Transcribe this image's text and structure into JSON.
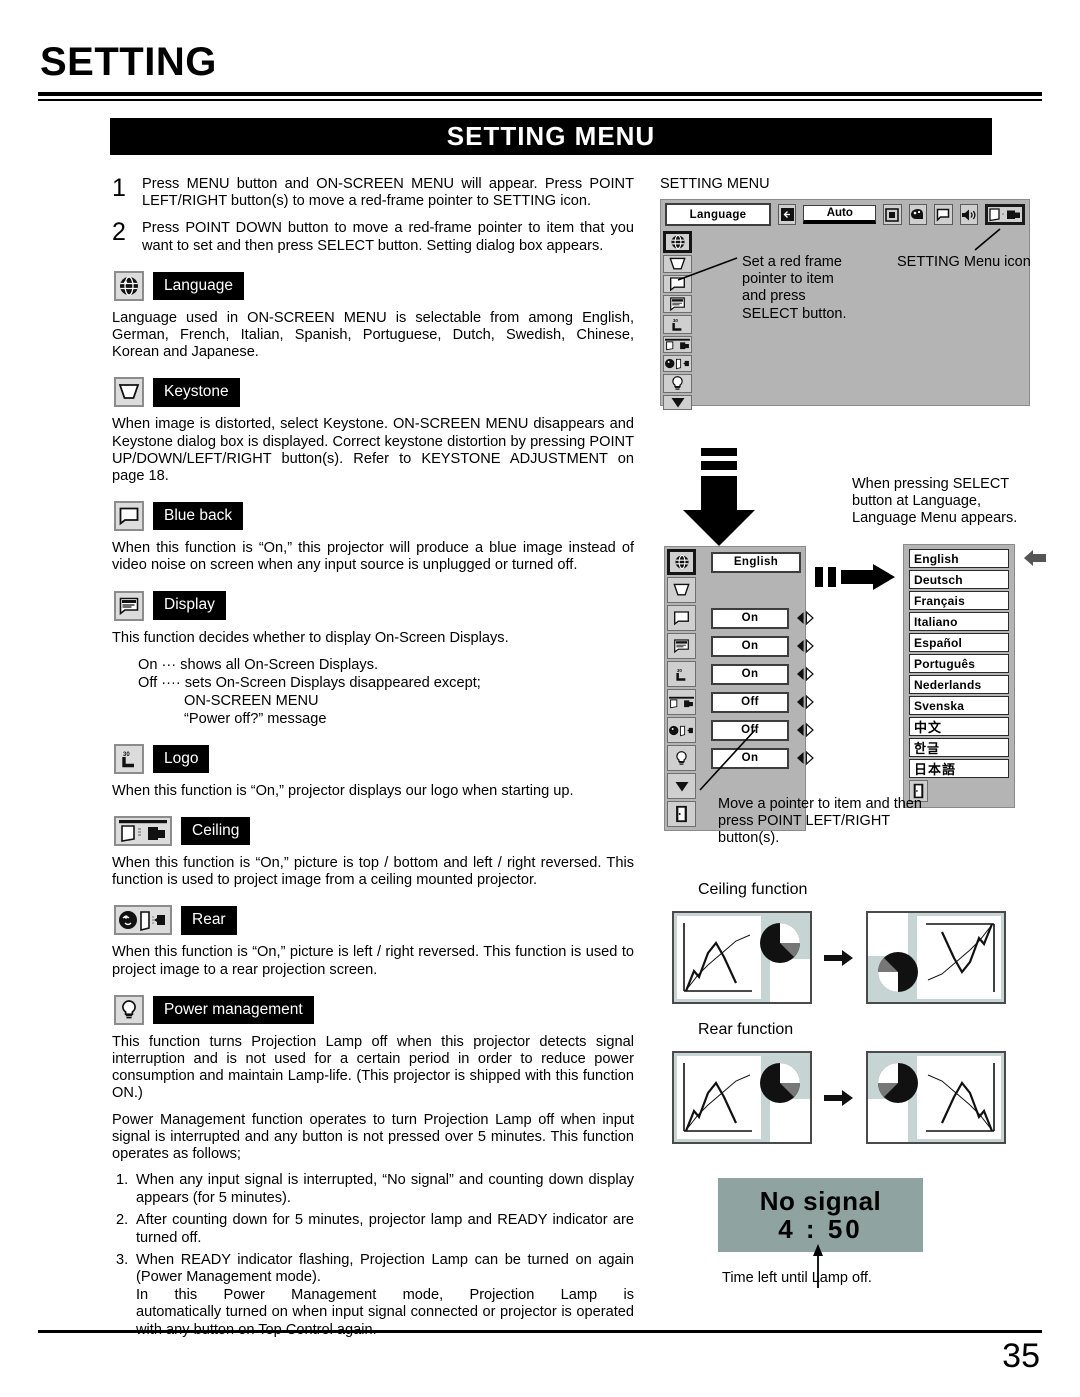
{
  "page": {
    "chapter_title": "SETTING",
    "banner_title": "SETTING MENU",
    "page_number": "35"
  },
  "steps": [
    {
      "num": "1",
      "text": "Press MENU button and ON-SCREEN MENU will appear.  Press POINT LEFT/RIGHT button(s) to move a red-frame pointer to SETTING icon."
    },
    {
      "num": "2",
      "text": "Press POINT DOWN button to move a red-frame pointer to item that you want to set and then press SELECT button.  Setting dialog box appears."
    }
  ],
  "sections": {
    "language": {
      "label": "Language",
      "icon": "globe-icon",
      "body": "Language used in ON-SCREEN MENU is selectable from among English, German, French, Italian, Spanish, Portuguese, Dutch, Swedish, Chinese, Korean and Japanese."
    },
    "keystone": {
      "label": "Keystone",
      "icon": "keystone-trapezoid-icon",
      "body": "When image is distorted, select Keystone.  ON-SCREEN MENU disappears and Keystone dialog box is displayed.  Correct keystone distortion by pressing POINT UP/DOWN/LEFT/RIGHT button(s). Refer to KEYSTONE ADJUSTMENT on page 18."
    },
    "blue_back": {
      "label": "Blue back",
      "icon": "blue-back-screen-icon",
      "body": "When this function is “On,” this projector will produce a blue image instead of video noise on screen when any input source is unplugged or turned off."
    },
    "display": {
      "label": "Display",
      "icon": "display-screen-icon",
      "body": "This function decides whether to display On-Screen Displays.",
      "on_line": "On  ···  shows all On-Screen Displays.",
      "off_line": "Off ···· sets On-Screen Displays disappeared except;",
      "off_sub1": "ON-SCREEN MENU",
      "off_sub2": "“Power off?” message"
    },
    "logo": {
      "label": "Logo",
      "icon": "logo-l-icon",
      "body": "When this function is “On,” projector displays our logo when starting up."
    },
    "ceiling": {
      "label": "Ceiling",
      "icon": "ceiling-projector-icon",
      "body": "When this function is “On,” picture is top / bottom and left / right reversed.  This function is used to project image from a ceiling mounted projector."
    },
    "rear": {
      "label": "Rear",
      "icon": "rear-projection-icon",
      "body": "When this function is “On,” picture is left / right reversed.  This function is used to project image to a rear projection screen."
    },
    "power_management": {
      "label": "Power management",
      "icon": "lamp-bulb-icon",
      "body1": "This function turns Projection Lamp off when this projector detects signal interruption and is not used for a certain period in order to reduce power consumption and maintain Lamp-life.  (This projector is shipped with this function ON.)",
      "body2": "Power Management function operates to turn Projection Lamp off when input signal is interrupted and any button is not pressed over 5 minutes. This function operates as follows;",
      "list": [
        {
          "num": "1.",
          "text": "When any input signal is interrupted, “No signal” and counting down display appears (for 5 minutes)."
        },
        {
          "num": "2.",
          "text": "After counting down for 5 minutes, projector lamp and READY indicator are turned off."
        },
        {
          "num": "3.",
          "text": "When READY indicator flashing, Projection Lamp can be turned on again (Power Management mode)."
        }
      ],
      "list3_extra_a": "In this Power Management mode, Projection Lamp is",
      "list3_extra_b": "automatically turned on when input signal connected or projector is operated with any button on Top Control again."
    }
  },
  "osd_main": {
    "caption": "SETTING MENU",
    "menubar": {
      "language_field": "Language",
      "auto_field": "Auto",
      "icons": [
        "input-icon",
        "screen-square-icon",
        "color-palette-icon",
        "image-icon",
        "sound-speaker-icon",
        "setting-projector-icon"
      ]
    },
    "side_icons": [
      "globe-icon",
      "keystone-trapezoid-icon",
      "blue-back-screen-icon",
      "display-screen-icon",
      "logo-l-icon",
      "ceiling-projector-icon",
      "rear-projection-icon",
      "lamp-bulb-icon",
      "scroll-down-icon"
    ],
    "annotation_left": "Set a red frame pointer to item and press SELECT button.",
    "annotation_right": "SETTING Menu icon"
  },
  "osd_dialog": {
    "rows": [
      {
        "icon": "globe-icon",
        "value": "English",
        "has_arrows": false,
        "selected": true
      },
      {
        "icon": "keystone-trapezoid-icon",
        "value": "",
        "has_arrows": false,
        "selected": false
      },
      {
        "icon": "blue-back-screen-icon",
        "value": "On",
        "has_arrows": true,
        "selected": false
      },
      {
        "icon": "display-screen-icon",
        "value": "On",
        "has_arrows": true,
        "selected": false
      },
      {
        "icon": "logo-l-icon",
        "value": "On",
        "has_arrows": true,
        "selected": false
      },
      {
        "icon": "ceiling-projector-icon",
        "value": "Off",
        "has_arrows": true,
        "selected": false
      },
      {
        "icon": "rear-projection-icon",
        "value": "Off",
        "has_arrows": true,
        "selected": false
      },
      {
        "icon": "lamp-bulb-icon",
        "value": "On",
        "has_arrows": true,
        "selected": false
      },
      {
        "icon": "scroll-down-icon",
        "value": "",
        "has_arrows": false,
        "selected": false
      },
      {
        "icon": "quit-door-icon",
        "value": "",
        "has_arrows": false,
        "selected": false
      }
    ],
    "annotation_select": "When pressing SELECT button at Language, Language Menu appears.",
    "annotation_pointer": "Move a pointer to item and then press POINT LEFT/RIGHT button(s)."
  },
  "language_menu": {
    "items": [
      "English",
      "Deutsch",
      "Français",
      "Italiano",
      "Español",
      "Português",
      "Nederlands",
      "Svenska",
      "中文",
      "한글",
      "日本語"
    ],
    "quit_icon": "quit-door-icon",
    "selected": "English"
  },
  "figures": {
    "ceiling_caption": "Ceiling function",
    "rear_caption": "Rear function"
  },
  "nosignal": {
    "title": "No signal",
    "time": "4 : 50",
    "caption": "Time left until Lamp off."
  }
}
